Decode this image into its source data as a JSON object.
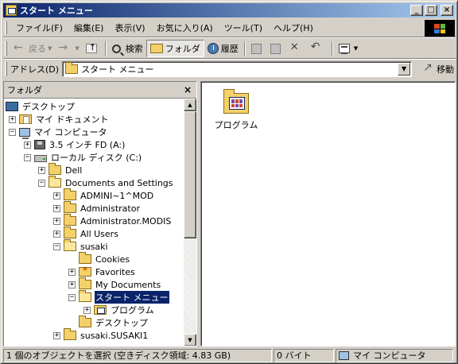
{
  "window": {
    "title": "スタート メニュー",
    "buttons": {
      "minimize": "_",
      "maximize": "□",
      "close": "×"
    }
  },
  "menubar": [
    "ファイル(F)",
    "編集(E)",
    "表示(V)",
    "お気に入り(A)",
    "ツール(T)",
    "ヘルプ(H)"
  ],
  "toolbar": {
    "back": "戻る",
    "search": "検索",
    "folders": "フォルダ",
    "history": "履歴",
    "icons": [
      "back-arrow-icon",
      "forward-arrow-icon",
      "up-folder-icon",
      "search-icon",
      "folder-icon",
      "history-icon",
      "move-to-icon",
      "copy-to-icon",
      "delete-icon",
      "undo-icon",
      "views-icon"
    ]
  },
  "address": {
    "label": "アドレス(D)",
    "value": "スタート メニュー",
    "go": "移動"
  },
  "folder_pane": {
    "header": "フォルダ",
    "close": "×",
    "tree": [
      {
        "label": "デスクトップ",
        "icon": "desktop-icon",
        "expander": ""
      },
      {
        "label": "マイ ドキュメント",
        "icon": "my-documents-icon",
        "expander": "+"
      },
      {
        "label": "マイ コンピュータ",
        "icon": "computer-icon",
        "expander": "−"
      },
      {
        "label": "3.5 インチ FD (A:)",
        "icon": "floppy-icon",
        "expander": "+"
      },
      {
        "label": "ローカル ディスク (C:)",
        "icon": "drive-icon",
        "expander": "−"
      },
      {
        "label": "Dell",
        "icon": "folder-icon",
        "expander": "+"
      },
      {
        "label": "Documents and Settings",
        "icon": "folder-open-icon",
        "expander": "−"
      },
      {
        "label": "ADMINI~1^MOD",
        "icon": "folder-icon",
        "expander": "+"
      },
      {
        "label": "Administrator",
        "icon": "folder-icon",
        "expander": "+"
      },
      {
        "label": "Administrator.MODIS",
        "icon": "folder-icon",
        "expander": "+"
      },
      {
        "label": "All Users",
        "icon": "folder-icon",
        "expander": "+"
      },
      {
        "label": "susaki",
        "icon": "folder-open-icon",
        "expander": "−"
      },
      {
        "label": "Cookies",
        "icon": "folder-icon",
        "expander": ""
      },
      {
        "label": "Favorites",
        "icon": "favorites-icon",
        "expander": "+"
      },
      {
        "label": "My Documents",
        "icon": "folder-icon",
        "expander": "+"
      },
      {
        "label": "スタート メニュー",
        "icon": "folder-open-icon",
        "expander": "−",
        "selected": true
      },
      {
        "label": "プログラム",
        "icon": "programs-folder-icon",
        "expander": "+"
      },
      {
        "label": "デスクトップ",
        "icon": "folder-icon",
        "expander": ""
      },
      {
        "label": "susaki.SUSAKI1",
        "icon": "folder-icon",
        "expander": "+"
      }
    ]
  },
  "content": {
    "items": [
      {
        "name": "プログラム",
        "icon": "programs-folder-icon"
      }
    ]
  },
  "statusbar": {
    "selection": "1 個のオブジェクトを選択 (空きディスク領域: 4.83 GB)",
    "size": "0 バイト",
    "zone": "マイ コンピュータ"
  },
  "colors": {
    "titlebar_start": "#0a246a",
    "titlebar_end": "#a6caf0",
    "face": "#d4d0c8",
    "selection": "#0a246a"
  }
}
